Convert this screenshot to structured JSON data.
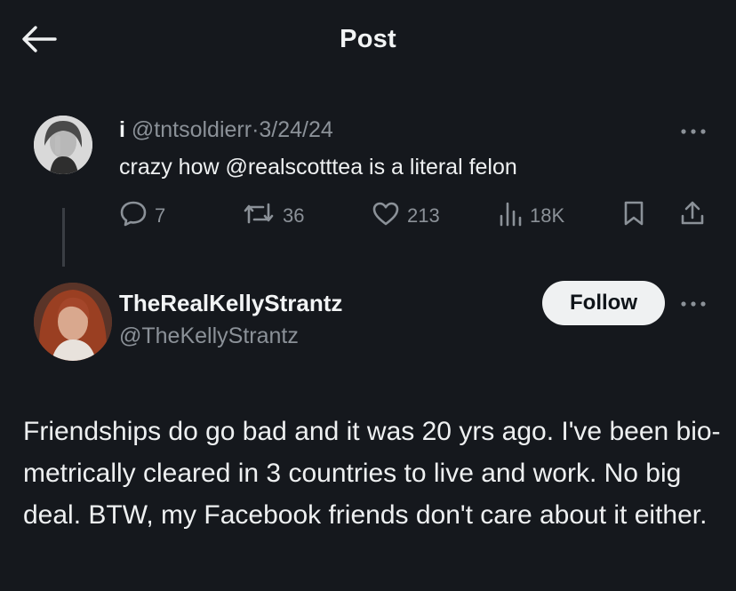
{
  "header": {
    "title": "Post"
  },
  "parent_tweet": {
    "display_name": "i",
    "handle": "@tntsoldierr",
    "separator": "·",
    "date": "3/24/24",
    "text": "crazy how @realscotttea is a literal felon",
    "stats": {
      "replies": "7",
      "reposts": "36",
      "likes": "213",
      "views": "18K"
    }
  },
  "reply_tweet": {
    "display_name": "TheRealKellyStrantz",
    "handle": "@TheKellyStrantz",
    "follow_label": "Follow",
    "text": "Friendships do go bad and it was 20 yrs ago. I've been bio-metrically cleared in 3 countries to live and work. No big deal. BTW, my Facebook friends don't care about it either."
  },
  "icons": {
    "back": "arrow-left-icon",
    "more": "more-horizontal-icon",
    "reply": "comment-bubble-icon",
    "repost": "repost-arrows-icon",
    "like": "heart-icon",
    "views": "bar-chart-icon",
    "bookmark": "bookmark-icon",
    "share": "share-upload-icon"
  },
  "colors": {
    "background": "#15181d",
    "text_primary": "#e7e9ea",
    "text_secondary": "#8b9198",
    "follow_bg": "#eff1f2"
  }
}
